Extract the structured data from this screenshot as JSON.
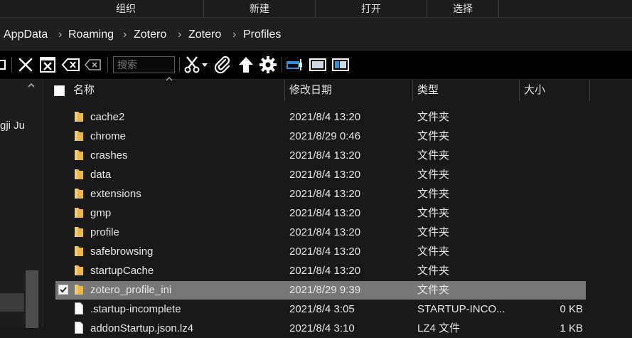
{
  "ribbon": {
    "groups": [
      "组织",
      "新建",
      "打开",
      "选择"
    ]
  },
  "breadcrumb": [
    "AppData",
    "Roaming",
    "Zotero",
    "Zotero",
    "Profiles"
  ],
  "breadcrumb_separator": "›",
  "toolbar": {
    "search_placeholder": "搜索",
    "icons": [
      "partial-icon",
      "close-icon",
      "close-box-icon",
      "backspace-icon",
      "backspace-outline-icon",
      "cut-icon",
      "dropdown-icon",
      "attach-icon",
      "up-arrow-icon",
      "gear-icon",
      "preview-pane-icon",
      "details-pane-icon",
      "layout-pane-icon"
    ]
  },
  "nav": {
    "partial_text": "gji Ju"
  },
  "columns": {
    "name": "名称",
    "date": "修改日期",
    "type": "类型",
    "size": "大小"
  },
  "files": [
    {
      "name": "cache2",
      "date": "2021/8/4 13:20",
      "type": "文件夹",
      "size": "",
      "kind": "folder",
      "selected": false
    },
    {
      "name": "chrome",
      "date": "2021/8/29 0:46",
      "type": "文件夹",
      "size": "",
      "kind": "folder",
      "selected": false
    },
    {
      "name": "crashes",
      "date": "2021/8/4 13:20",
      "type": "文件夹",
      "size": "",
      "kind": "folder",
      "selected": false
    },
    {
      "name": "data",
      "date": "2021/8/4 13:20",
      "type": "文件夹",
      "size": "",
      "kind": "folder",
      "selected": false
    },
    {
      "name": "extensions",
      "date": "2021/8/4 13:20",
      "type": "文件夹",
      "size": "",
      "kind": "folder",
      "selected": false
    },
    {
      "name": "gmp",
      "date": "2021/8/4 13:20",
      "type": "文件夹",
      "size": "",
      "kind": "folder",
      "selected": false
    },
    {
      "name": "profile",
      "date": "2021/8/4 13:20",
      "type": "文件夹",
      "size": "",
      "kind": "folder",
      "selected": false
    },
    {
      "name": "safebrowsing",
      "date": "2021/8/4 13:20",
      "type": "文件夹",
      "size": "",
      "kind": "folder",
      "selected": false
    },
    {
      "name": "startupCache",
      "date": "2021/8/4 13:20",
      "type": "文件夹",
      "size": "",
      "kind": "folder",
      "selected": false
    },
    {
      "name": "zotero_profile_ini",
      "date": "2021/8/29 9:39",
      "type": "文件夹",
      "size": "",
      "kind": "folder",
      "selected": true
    },
    {
      "name": ".startup-incomplete",
      "date": "2021/8/4 3:05",
      "type": "STARTUP-INCO...",
      "size": "0 KB",
      "kind": "file",
      "selected": false
    },
    {
      "name": "addonStartup.json.lz4",
      "date": "2021/8/4 3:10",
      "type": "LZ4 文件",
      "size": "1 KB",
      "kind": "file",
      "selected": false
    }
  ],
  "colors": {
    "background": "#191919",
    "selected_row": "#777777",
    "folder": "#e8b84a",
    "accent_blue": "#2f8fe0"
  }
}
